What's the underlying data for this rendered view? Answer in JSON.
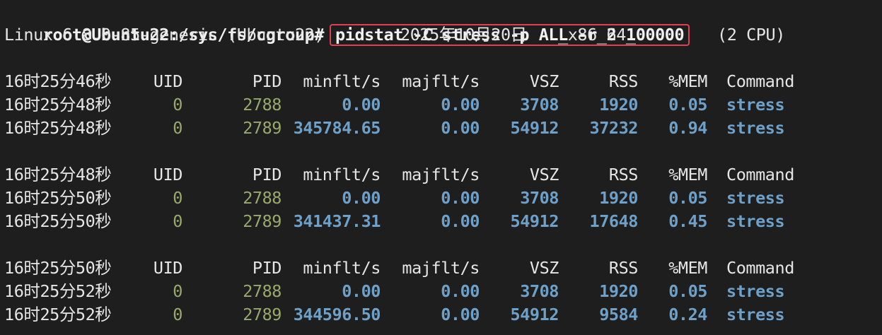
{
  "prompt": "root@Ubuntu22:/sys/fs/cgroup#",
  "command": "pidstat -C stress -p ALL -r 2 100000",
  "sysinfo": {
    "kernel": "Linux 6.8.0-85-generic (Ubuntu22)",
    "date": "2025年10月20日",
    "arch": "_x86_64_",
    "cpus": "(2 CPU)"
  },
  "columns": [
    "UID",
    "PID",
    "minflt/s",
    "majflt/s",
    "VSZ",
    "RSS",
    "%MEM",
    "Command"
  ],
  "blocks": [
    {
      "header_time": "16时25分46秒",
      "rows": [
        {
          "time": "16时25分48秒",
          "uid": "0",
          "pid": "2788",
          "minflt": "0.00",
          "majflt": "0.00",
          "vsz": "3708",
          "rss": "1920",
          "mem": "0.05",
          "cmd": "stress"
        },
        {
          "time": "16时25分48秒",
          "uid": "0",
          "pid": "2789",
          "minflt": "345784.65",
          "majflt": "0.00",
          "vsz": "54912",
          "rss": "37232",
          "mem": "0.94",
          "cmd": "stress"
        }
      ]
    },
    {
      "header_time": "16时25分48秒",
      "rows": [
        {
          "time": "16时25分50秒",
          "uid": "0",
          "pid": "2788",
          "minflt": "0.00",
          "majflt": "0.00",
          "vsz": "3708",
          "rss": "1920",
          "mem": "0.05",
          "cmd": "stress"
        },
        {
          "time": "16时25分50秒",
          "uid": "0",
          "pid": "2789",
          "minflt": "341437.31",
          "majflt": "0.00",
          "vsz": "54912",
          "rss": "17648",
          "mem": "0.45",
          "cmd": "stress"
        }
      ]
    },
    {
      "header_time": "16时25分50秒",
      "rows": [
        {
          "time": "16时25分52秒",
          "uid": "0",
          "pid": "2788",
          "minflt": "0.00",
          "majflt": "0.00",
          "vsz": "3708",
          "rss": "1920",
          "mem": "0.05",
          "cmd": "stress"
        },
        {
          "time": "16时25分52秒",
          "uid": "0",
          "pid": "2789",
          "minflt": "344596.50",
          "majflt": "0.00",
          "vsz": "54912",
          "rss": "9584",
          "mem": "0.24",
          "cmd": "stress"
        }
      ]
    }
  ],
  "colors": {
    "background": "#1e1e1e",
    "highlight_border": "#e04052",
    "uid_pid": "#9aa86e",
    "values": "#6fa0c8"
  }
}
